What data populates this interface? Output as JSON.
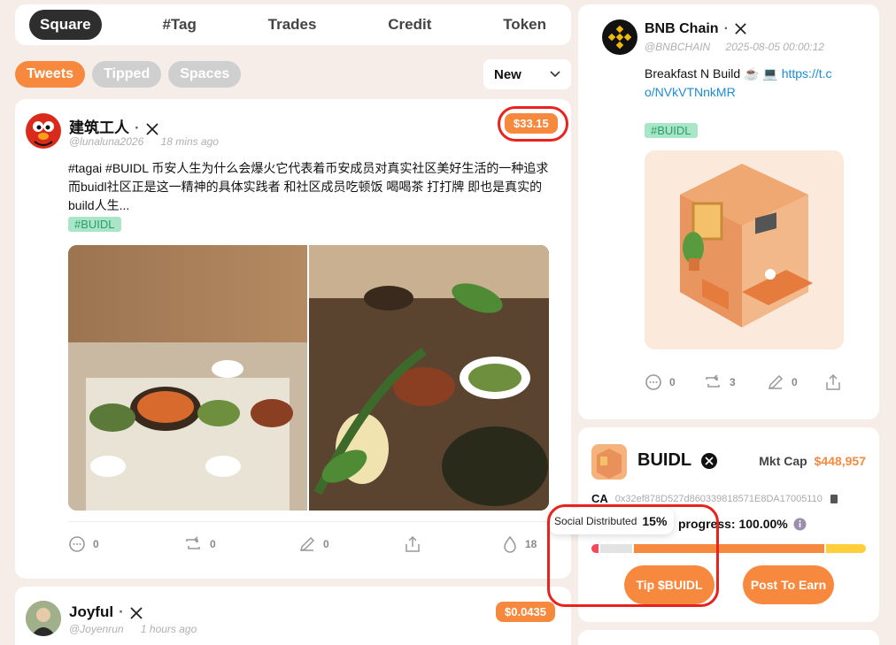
{
  "nav": {
    "tabs": [
      "Square",
      "#Tag",
      "Trades",
      "Credit",
      "Token"
    ],
    "subtabs": [
      "Tweets",
      "Tipped",
      "Spaces"
    ],
    "sort": "New"
  },
  "post1": {
    "name": "建筑工人",
    "handle": "@lunaluna2026",
    "time": "18 mins ago",
    "price": "$33.15",
    "text": "#tagai #BUIDL 币安人生为什么会爆火它代表着币安成员对真实社区美好生活的一种追求而buidl社区正是这一精神的具体实践者 和社区成员吃顿饭 喝喝茶 打打牌 即也是真实的build人生...",
    "tag": "#BUIDL",
    "comments": "0",
    "retweets": "0",
    "edits": "0",
    "tips": "18"
  },
  "post2": {
    "name": "Joyful",
    "handle": "@Joyenrun",
    "time": "1 hours ago",
    "price": "$0.0435"
  },
  "bnb": {
    "name": "BNB Chain",
    "handle": "@BNBCHAIN",
    "time": "2025-08-05 00:00:12",
    "text": "Breakfast N Build ☕ 💻",
    "link": "https://t.co/NVkVTNnkMR",
    "link_line1": "https://t.c",
    "link_line2": "o/NVkVTNnkMR",
    "tag": "#BUIDL",
    "comments": "0",
    "retweets": "3",
    "edits": "0"
  },
  "token": {
    "name": "BUIDL",
    "mkt_label": "Mkt Cap",
    "mkt_value": "$448,957",
    "ca_label": "CA",
    "ca": "0x32ef878D527d860339818571E8DA17005110",
    "progress_label": "progress: 100.00%",
    "tooltip_label": "Social Distributed",
    "tooltip_value": "15%",
    "tip_btn": "Tip $BUIDL",
    "post_btn": "Post To Earn",
    "progress": 1.0
  },
  "colors": {
    "accent": "#f7893f",
    "ring": "#e8221c",
    "tag_bg": "#a9e6c8",
    "tag_fg": "#2c9c6c"
  }
}
